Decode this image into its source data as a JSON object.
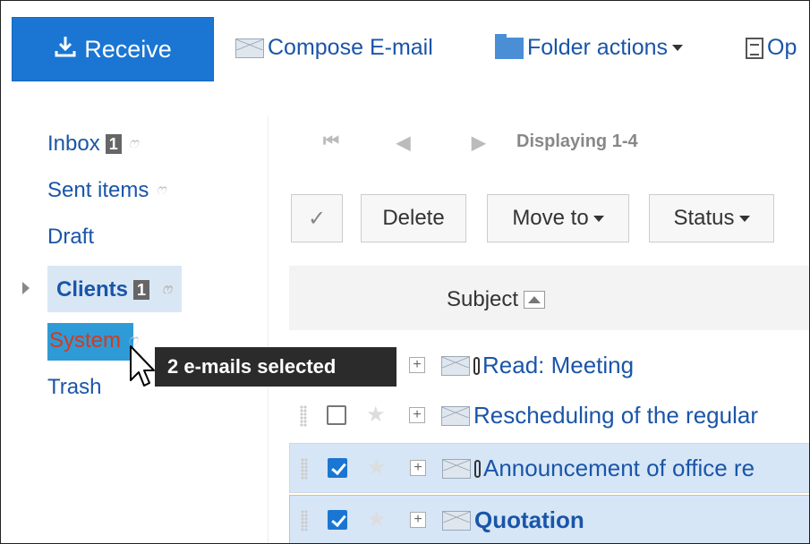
{
  "toolbar": {
    "receive_label": "Receive",
    "compose_label": "Compose E-mail",
    "folder_actions_label": "Folder actions",
    "options_label": "Op"
  },
  "sidebar": {
    "items": [
      {
        "label": "Inbox",
        "badge": "1"
      },
      {
        "label": "Sent items"
      },
      {
        "label": "Draft"
      },
      {
        "label": "Clients",
        "badge": "1"
      },
      {
        "label": "System"
      },
      {
        "label": "Trash"
      }
    ]
  },
  "pager": {
    "display_text": "Displaying 1-4",
    "first": "⏮",
    "prev": "◀",
    "next": "▶"
  },
  "actions": {
    "delete_label": "Delete",
    "move_to_label": "Move to",
    "status_label": "Status",
    "check_mark": "✓"
  },
  "table": {
    "subject_header": "Subject",
    "rows": [
      {
        "subject": "Read: Meeting",
        "checked": false,
        "attachment": true
      },
      {
        "subject": "Rescheduling of the regular",
        "checked": false,
        "attachment": false
      },
      {
        "subject": "Announcement of office re",
        "checked": true,
        "attachment": true
      },
      {
        "subject": "Quotation",
        "checked": true,
        "attachment": false,
        "bold": true
      }
    ]
  },
  "tooltip": {
    "text": "2 e-mails selected"
  },
  "icons": {
    "receive": "download-icon",
    "compose": "envelope-icon",
    "folder": "folder-icon",
    "options": "document-icon",
    "rss": "rss-icon",
    "cursor": "pointer-cursor-icon"
  },
  "colors": {
    "accent": "#1a76d2",
    "link": "#1a55a8",
    "selected_row": "#d6e6f6",
    "drop_target": "#2f9bd6",
    "drop_target_text": "#d43a1e",
    "tooltip_bg": "#2b2b2b"
  }
}
